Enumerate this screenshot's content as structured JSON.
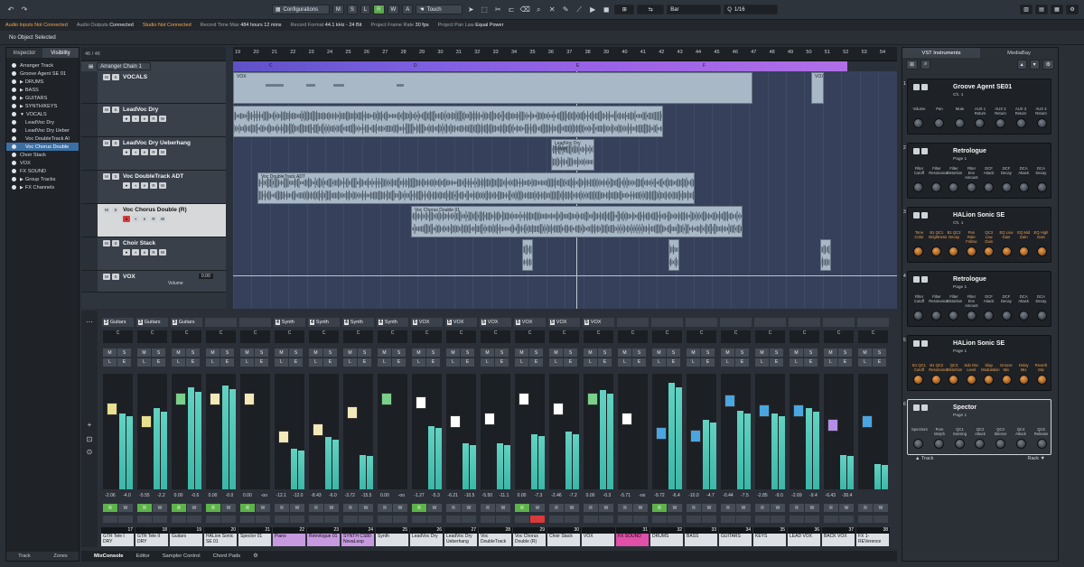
{
  "toolbar": {
    "configurations_label": "Configurations",
    "mode_letters": [
      "M",
      "S",
      "L",
      "R",
      "W",
      "A"
    ],
    "automation_mode": "Touch",
    "grid_type": "Bar",
    "quantize_value": "1/16"
  },
  "status": {
    "audio_inputs_label": "Audio Inputs",
    "audio_inputs_value": "Not Connected",
    "audio_outputs_label": "Audio Outputs",
    "audio_outputs_value": "Connected",
    "studio_label": "Studio",
    "studio_value": "Not Connected",
    "record_time_label": "Record Time Max",
    "record_time_value": "484 hours 12 mins",
    "record_format_label": "Record Format",
    "record_format_value": "44.1 kHz - 24 Bit",
    "frame_rate_label": "Project Frame Rate",
    "frame_rate_value": "30 fps",
    "pan_law_label": "Project Pan Law",
    "pan_law_value": "Equal Power"
  },
  "info_line": "No Object Selected",
  "left_zone": {
    "tabs": [
      "Inspector",
      "Visibility"
    ],
    "items": [
      "Arranger Track",
      "Groove Agent SE 01",
      "DRUMS",
      "BASS",
      "GUITARS",
      "SYNTH/KEYS",
      "VOCALS",
      "LeadVoc Dry",
      "LeadVoc Dry Ueber",
      "Voc DoubleTrack AI",
      "Voc Chorus Double",
      "Choir Stack",
      "VOX",
      "FX SOUND",
      "Group Tracks",
      "FX Channels"
    ],
    "bottom_tabs": [
      "Track",
      "Zones"
    ]
  },
  "project": {
    "track_count": "46 / 46",
    "arranger_chain": "Arranger Chain 1",
    "tracks": [
      {
        "name": "VOCALS"
      },
      {
        "name": "LeadVoc Dry"
      },
      {
        "name": "LeadVoc Dry Ueberhang"
      },
      {
        "name": "Voc DoubleTrack ADT"
      },
      {
        "name": "Voc Chorus Double (R)"
      },
      {
        "name": "Choir Stack"
      },
      {
        "name": "VOX"
      }
    ],
    "vox_volume_label": "Volume",
    "vox_volume_value": "0.00",
    "ruler": [
      "19",
      "20",
      "21",
      "22",
      "23",
      "24",
      "25",
      "26",
      "27",
      "28",
      "29",
      "30",
      "31",
      "32",
      "33",
      "34",
      "35",
      "36",
      "37",
      "38",
      "39",
      "40",
      "41",
      "42",
      "43",
      "44",
      "45",
      "46",
      "47",
      "48",
      "49",
      "50",
      "51",
      "52",
      "53",
      "54"
    ],
    "arranger_sections": [
      "C",
      "D",
      "E",
      "F"
    ],
    "events": [
      "VOX",
      "VOX",
      "LeadVoc Dry Ueber",
      "Voc DoubleTrack ADT",
      "Voc Chorus Double 01"
    ]
  },
  "mixer": {
    "channels": [
      {
        "route_num": "3",
        "route": "Guitars",
        "vol": "-2.06",
        "peak": "-4.0",
        "num": "17",
        "label": "GTR Tele I DRY",
        "color": "#e8e090",
        "fader": 0.72,
        "meter": 0.66
      },
      {
        "route_num": "3",
        "route": "Guitars",
        "vol": "-5.55",
        "peak": "-2.2",
        "num": "18",
        "label": "GTR Tele II DRY",
        "color": "#e8e090",
        "fader": 0.6,
        "meter": 0.7
      },
      {
        "route_num": "3",
        "route": "Guitars",
        "vol": "0.00",
        "peak": "-0.6",
        "num": "19",
        "label": "Guitars",
        "color": "#7ad08a",
        "fader": 0.82,
        "meter": 0.88
      },
      {
        "route_num": "",
        "route": "",
        "vol": "0.00",
        "peak": "-0.0",
        "num": "20",
        "label": "HALion Sonic SE 01",
        "color": "#f2e8b8",
        "fader": 0.82,
        "meter": 0.9
      },
      {
        "route_num": "",
        "route": "",
        "vol": "0.00",
        "peak": "-oo",
        "num": "21",
        "label": "Spector 01",
        "color": "#f2e8b8",
        "fader": 0.82,
        "meter": 0.0
      },
      {
        "route_num": "4",
        "route": "Synth",
        "vol": "-12.1",
        "peak": "-12.0",
        "num": "22",
        "label": "Piano",
        "color": "#f2e8b8",
        "fader": 0.45,
        "meter": 0.35,
        "label_color": "#c79ae0"
      },
      {
        "route_num": "4",
        "route": "Synth",
        "vol": "-8.43",
        "peak": "-6.0",
        "num": "23",
        "label": "Retrologue 01",
        "color": "#f2e8b8",
        "fader": 0.52,
        "meter": 0.45,
        "label_color": "#c79ae0"
      },
      {
        "route_num": "4",
        "route": "Synth",
        "vol": "-3.72",
        "peak": "-15.5",
        "num": "24",
        "label": "SYNTH CS80 NovaLoop",
        "color": "#f2e8b8",
        "fader": 0.68,
        "meter": 0.3,
        "label_color": "#c79ae0"
      },
      {
        "route_num": "4",
        "route": "Synth",
        "vol": "0.00",
        "peak": "-oo",
        "num": "25",
        "label": "Synth",
        "color": "#7ad08a",
        "fader": 0.82,
        "meter": 0.0
      },
      {
        "route_num": "5",
        "route": "VOX",
        "vol": "-1.27",
        "peak": "-5.3",
        "num": "26",
        "label": "LeadVoc Dry",
        "color": "#ffffff",
        "fader": 0.78,
        "meter": 0.55
      },
      {
        "route_num": "5",
        "route": "VOX",
        "vol": "-6.21",
        "peak": "-10.5",
        "num": "27",
        "label": "LeadVoc Dry Ueberhang",
        "color": "#ffffff",
        "fader": 0.6,
        "meter": 0.4
      },
      {
        "route_num": "5",
        "route": "VOX",
        "vol": "-5.50",
        "peak": "-11.1",
        "num": "28",
        "label": "Voc DoubleTrack",
        "color": "#ffffff",
        "fader": 0.62,
        "meter": 0.4
      },
      {
        "route_num": "5",
        "route": "VOX",
        "vol": "0.00",
        "peak": "-7.3",
        "num": "29",
        "label": "Voc Chorus Double (R)",
        "color": "#ffffff",
        "fader": 0.82,
        "meter": 0.48
      },
      {
        "route_num": "5",
        "route": "VOX",
        "vol": "-2.46",
        "peak": "-7.2",
        "num": "30",
        "label": "Choir Stack",
        "color": "#ffffff",
        "fader": 0.72,
        "meter": 0.5
      },
      {
        "route_num": "5",
        "route": "VOX",
        "vol": "0.00",
        "peak": "-0.3",
        "num": "",
        "label": "VOX",
        "color": "#7ad08a",
        "fader": 0.82,
        "meter": 0.86
      },
      {
        "route_num": "",
        "route": "",
        "vol": "-5.71",
        "peak": "-oo",
        "num": "31",
        "label": "FX SOUND",
        "color": "#ffffff",
        "fader": 0.62,
        "meter": 0.0,
        "label_color": "#e04fa8"
      },
      {
        "route_num": "",
        "route": "",
        "vol": "-9.72",
        "peak": "-6.4",
        "num": "32",
        "label": "DRUMS",
        "color": "#4aa6e0",
        "fader": 0.48,
        "meter": 0.92
      },
      {
        "route_num": "",
        "route": "",
        "vol": "-10.0",
        "peak": "-4.7",
        "num": "33",
        "label": "BASS",
        "color": "#4aa6e0",
        "fader": 0.46,
        "meter": 0.6
      },
      {
        "route_num": "",
        "route": "",
        "vol": "-0.44",
        "peak": "-7.5",
        "num": "34",
        "label": "GUITARS",
        "color": "#4aa6e0",
        "fader": 0.8,
        "meter": 0.68
      },
      {
        "route_num": "",
        "route": "",
        "vol": "-2.85",
        "peak": "-9.0",
        "num": "35",
        "label": "KEYS",
        "color": "#4aa6e0",
        "fader": 0.7,
        "meter": 0.66
      },
      {
        "route_num": "",
        "route": "",
        "vol": "-2.69",
        "peak": "-9.4",
        "num": "36",
        "label": "LEAD VOX",
        "color": "#4aa6e0",
        "fader": 0.7,
        "meter": 0.7
      },
      {
        "route_num": "",
        "route": "",
        "vol": "-6.43",
        "peak": "-30.4",
        "num": "37",
        "label": "BACK VOX",
        "color": "#b48ee8",
        "fader": 0.56,
        "meter": 0.3
      },
      {
        "route_num": "",
        "route": "",
        "vol": "",
        "peak": "",
        "num": "38",
        "label": "FX 1-REVerence",
        "color": "#4aa6e0",
        "fader": 0.6,
        "meter": 0.22
      }
    ]
  },
  "bottom_tabs": [
    "Track",
    "Zones",
    "MixConsole",
    "Editor",
    "Sampler Control",
    "Chord Pads"
  ],
  "right_zone": {
    "tabs": [
      "VST Instruments",
      "MediaBay"
    ],
    "instruments": [
      {
        "idx": "1",
        "name": "Groove Agent SE01",
        "sub": "Ch. 1",
        "labels": [
          "Volume",
          "Pan",
          "Mute",
          "AUX 1 Return",
          "AUX 2 Return",
          "AUX 3 Return",
          "AUX 4 Return"
        ],
        "orange": false
      },
      {
        "idx": "2",
        "name": "Retrologue",
        "sub": "Page 1",
        "labels": [
          "Filter Cutoff",
          "Filter Resonance",
          "Filter Distortion",
          "Filter Env Amount",
          "DCF Attack",
          "DCF Decay",
          "DCA Attack",
          "DCA Decay"
        ],
        "orange": false
      },
      {
        "idx": "3",
        "name": "HALion Sonic SE",
        "sub": "Ch. 1",
        "labels": [
          "Tone Color",
          "B1 QC1 Brightness",
          "B1 QC2 Decay",
          "Pan Rate Follow",
          "QC3 Low Gain",
          "EQ Low Gain",
          "EQ Mid Gain",
          "EQ High Gain"
        ],
        "orange": true
      },
      {
        "idx": "4",
        "name": "Retrologue",
        "sub": "Page 1",
        "labels": [
          "Filter Cutoff",
          "Filter Resonance",
          "Filter Distortion",
          "Filter Env Amount",
          "DCF Attack",
          "DCF Decay",
          "DCA Attack",
          "DCA Decay"
        ],
        "orange": false
      },
      {
        "idx": "5",
        "name": "HALion Sonic SE",
        "sub": "Page 1",
        "labels": [
          "B1 QC1 Cutoff",
          "B1 QC2 Resonance",
          "QC3 Distortion",
          "Sub Osc Level",
          "Slap Modulation",
          "Groove Mix",
          "Delay Mix",
          "Reverb Mix"
        ],
        "orange": true
      },
      {
        "idx": "6",
        "name": "Spector",
        "sub": "Page 1",
        "labels": [
          "Spectrum",
          "Pure Morph",
          "QC1 Sensing",
          "QC2 Attack",
          "QC3 Silence",
          "QC4 Attack",
          "QC5 Release"
        ],
        "orange": false
      }
    ],
    "footer_left": "Track",
    "footer_right": "Rack"
  }
}
